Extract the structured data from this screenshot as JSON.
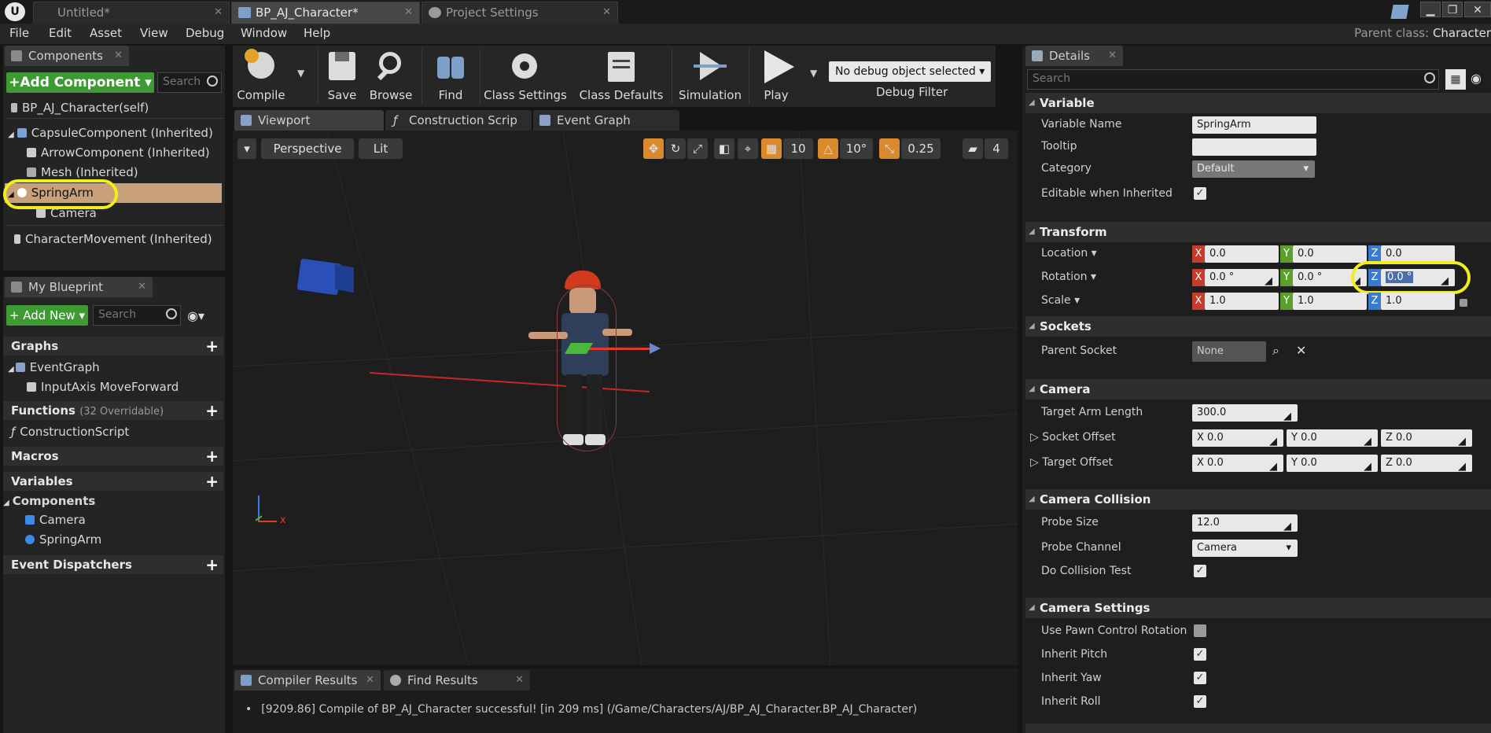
{
  "titlebar": {
    "tabs": [
      {
        "label": "Untitled*"
      },
      {
        "label": "BP_AJ_Character*"
      },
      {
        "label": "Project Settings"
      }
    ]
  },
  "menu": [
    "File",
    "Edit",
    "Asset",
    "View",
    "Debug",
    "Window",
    "Help"
  ],
  "parent_class": {
    "label": "Parent class:",
    "value": "Character"
  },
  "components": {
    "tab": "Components",
    "add_label": "+Add Component",
    "search_placeholder": "Search",
    "self": "BP_AJ_Character(self)",
    "items": [
      {
        "label": "CapsuleComponent (Inherited)"
      },
      {
        "label": "ArrowComponent (Inherited)"
      },
      {
        "label": "Mesh (Inherited)"
      },
      {
        "label": "SpringArm",
        "selected": true
      },
      {
        "label": "Camera"
      },
      {
        "label": "CharacterMovement (Inherited)"
      }
    ]
  },
  "my_blueprint": {
    "tab": "My Blueprint",
    "add_label": "+ Add New",
    "search_placeholder": "Search",
    "sections": {
      "graphs": "Graphs",
      "event_graph": "EventGraph",
      "input_axis": "InputAxis MoveForward",
      "functions": "Functions",
      "functions_sub": "(32 Overridable)",
      "construction": "ConstructionScript",
      "macros": "Macros",
      "variables": "Variables",
      "components": "Components",
      "camera": "Camera",
      "springarm": "SpringArm",
      "dispatchers": "Event Dispatchers"
    }
  },
  "toolbar": {
    "compile": "Compile",
    "save": "Save",
    "browse": "Browse",
    "find": "Find",
    "class_settings": "Class Settings",
    "class_defaults": "Class Defaults",
    "simulation": "Simulation",
    "play": "Play",
    "debug_select": "No debug object selected",
    "debug_filter": "Debug Filter"
  },
  "editor_tabs": [
    "Viewport",
    "Construction Scrip",
    "Event Graph"
  ],
  "viewport": {
    "perspective": "Perspective",
    "lit": "Lit",
    "grid_snap": "10",
    "rot_snap": "10°",
    "scale_snap": "0.25",
    "camera_speed": "4",
    "axis_x_label": "x"
  },
  "bottom": {
    "tabs": [
      "Compiler Results",
      "Find Results"
    ],
    "message": "[9209.86] Compile of BP_AJ_Character successful! [in 209 ms] (/Game/Characters/AJ/BP_AJ_Character.BP_AJ_Character)"
  },
  "details": {
    "tab": "Details",
    "search_placeholder": "Search",
    "variable": {
      "header": "Variable",
      "name_label": "Variable Name",
      "name_value": "SpringArm",
      "tooltip_label": "Tooltip",
      "tooltip_value": "",
      "category_label": "Category",
      "category_value": "Default",
      "editable_label": "Editable when Inherited"
    },
    "transform": {
      "header": "Transform",
      "location": "Location",
      "rotation": "Rotation",
      "scale": "Scale",
      "loc": [
        "0.0",
        "0.0",
        "0.0"
      ],
      "rot": [
        "0.0 °",
        "0.0 °",
        "0.0 °"
      ],
      "scl": [
        "1.0",
        "1.0",
        "1.0"
      ]
    },
    "sockets": {
      "header": "Sockets",
      "parent_label": "Parent Socket",
      "parent_value": "None"
    },
    "camera": {
      "header": "Camera",
      "arm_label": "Target Arm Length",
      "arm_value": "300.0",
      "socket_label": "Socket Offset",
      "target_label": "Target Offset",
      "socket": [
        "X  0.0",
        "Y  0.0",
        "Z  0.0"
      ],
      "target": [
        "X  0.0",
        "Y  0.0",
        "Z  0.0"
      ]
    },
    "collision": {
      "header": "Camera Collision",
      "probe_size_label": "Probe Size",
      "probe_size_value": "12.0",
      "probe_channel_label": "Probe Channel",
      "probe_channel_value": "Camera",
      "do_test_label": "Do Collision Test"
    },
    "settings": {
      "header": "Camera Settings",
      "pawn_label": "Use Pawn Control Rotation",
      "pitch_label": "Inherit Pitch",
      "yaw_label": "Inherit Yaw",
      "roll_label": "Inherit Roll"
    }
  },
  "colors": {
    "accent_green": "#3e9a33",
    "highlight_yellow": "#f2ee1c",
    "selected_row": "#c8a07a"
  }
}
